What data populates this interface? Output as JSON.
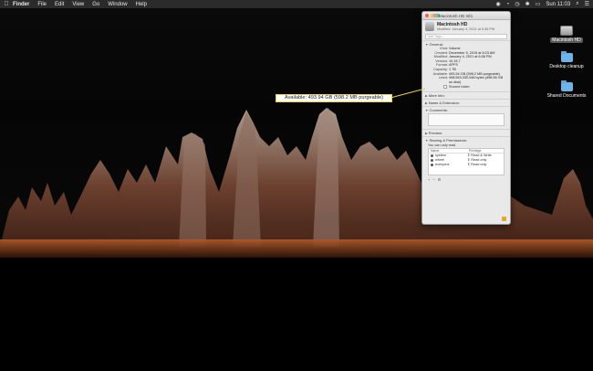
{
  "menubar": {
    "apple": "",
    "items": [
      "Finder",
      "File",
      "Edit",
      "View",
      "Go",
      "Window",
      "Help"
    ],
    "clock": "Sun 11:03"
  },
  "desktop": {
    "icons": [
      {
        "label": "Macintosh HD",
        "icon": "hard-drive-icon"
      },
      {
        "label": "Desktop cleanup",
        "icon": "folder-icon"
      },
      {
        "label": "Shared Documents",
        "icon": "folder-icon"
      }
    ]
  },
  "info_window": {
    "title": "Macintosh HD Info",
    "name": "Macintosh HD",
    "modified_header": "Modified: January 4, 2021 at 6:36 PM",
    "tags_placeholder": "Add Tags...",
    "general": {
      "header": "General:",
      "rows": [
        {
          "k": "Kind:",
          "v": "Volume"
        },
        {
          "k": "Created:",
          "v": "December 5, 2019 at 6:23 AM"
        },
        {
          "k": "Modified:",
          "v": "January 4, 2021 at 6:36 PM"
        },
        {
          "k": "Version:",
          "v": "10.15.7"
        },
        {
          "k": "Format:",
          "v": "APFS"
        },
        {
          "k": "Capacity:",
          "v": "1 TB"
        },
        {
          "k": "Available:",
          "v": "493.94 GB (598.2 MB purgeable)"
        },
        {
          "k": "Used:",
          "v": "498,563,330,048 bytes (498.56 GB on disk)"
        }
      ],
      "shared_folder": "Shared folder"
    },
    "sections": {
      "more_info": "More Info:",
      "name_ext": "Name & Extension:",
      "comments": "Comments:",
      "preview": "Preview:",
      "sharing": "Sharing & Permissions:"
    },
    "permissions": {
      "note": "You can only read",
      "col_name": "Name",
      "col_priv": "Privilege",
      "rows": [
        {
          "name": "system",
          "priv": "⇕ Read & Write"
        },
        {
          "name": "wheel",
          "priv": "⇕ Read only"
        },
        {
          "name": "everyone",
          "priv": "⇕ Read only"
        }
      ]
    }
  },
  "callout": {
    "text": "Available: 493.94 GB (598.2 MB purgeable)",
    "border_color": "#f2d23a"
  }
}
